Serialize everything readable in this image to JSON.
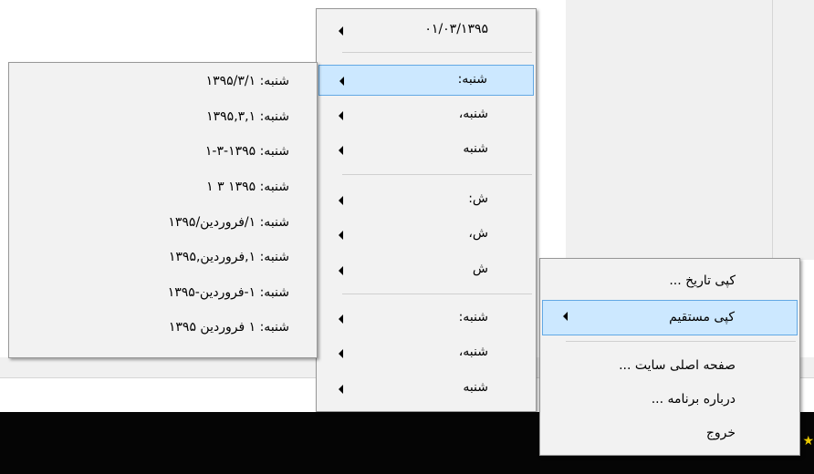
{
  "menu_main": {
    "items": [
      {
        "label": "کپی تاریخ ..."
      },
      {
        "label": "کپی مستقیم"
      },
      {
        "label": "صفحه اصلی سایت ..."
      },
      {
        "label": "درباره برنامه ..."
      },
      {
        "label": "خروج"
      }
    ]
  },
  "menu_formats": {
    "items": [
      {
        "label": "۰۱/۰۳/۱۳۹۵"
      },
      {
        "label": "شنبه:"
      },
      {
        "label": "شنبه،"
      },
      {
        "label": "شنبه"
      },
      {
        "label": "ش:"
      },
      {
        "label": "ش،"
      },
      {
        "label": "ش"
      },
      {
        "label": "شنبه:"
      },
      {
        "label": "شنبه،"
      },
      {
        "label": "شنبه"
      }
    ]
  },
  "menu_dates": {
    "items": [
      {
        "label": "شنبه: ۱۳۹۵/۳/۱"
      },
      {
        "label": "شنبه: ۱۳۹۵,۳,۱"
      },
      {
        "label": "شنبه: ۱۳۹۵-۳-۱"
      },
      {
        "label": "شنبه: ۱۳۹۵ ۳ ۱"
      },
      {
        "label": "شنبه: ۱/فروردین/۱۳۹۵"
      },
      {
        "label": "شنبه: ۱,فروردین,۱۳۹۵"
      },
      {
        "label": "شنبه: ۱-فروردین-۱۳۹۵"
      },
      {
        "label": "شنبه: ۱ فروردین ۱۳۹۵"
      }
    ]
  },
  "colors": {
    "highlight": "#cce8ff",
    "highlight_border": "#62a8e4",
    "menu_bg": "#f2f2f2",
    "taskbar": "#050505",
    "tray_star": "#e8c800"
  },
  "icons": {
    "tray": "star-icon"
  }
}
